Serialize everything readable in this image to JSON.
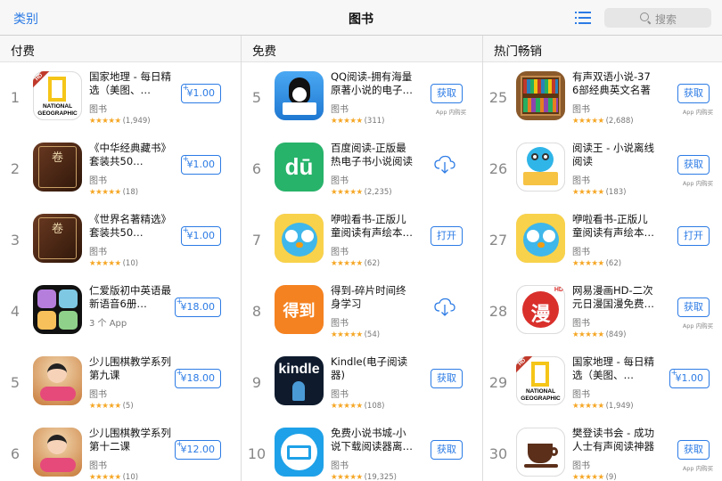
{
  "nav": {
    "back": "类别",
    "title": "图书",
    "search_placeholder": "搜索"
  },
  "columns": [
    {
      "title": "付费",
      "apps": [
        {
          "rank": "1",
          "name": "国家地理 - 每日精选（美图、…",
          "category": "图书",
          "stars": "★★★★★",
          "ratings": "(1,949)",
          "action": "¥1.00",
          "action_type": "price",
          "icon": "natgeo-icon"
        },
        {
          "rank": "2",
          "name": "《中华经典藏书》套装共50…",
          "category": "图书",
          "stars": "★★★★★",
          "ratings": "(18)",
          "action": "¥1.00",
          "action_type": "price",
          "icon": "book-cover-icon"
        },
        {
          "rank": "3",
          "name": "《世界名著精选》套装共50…",
          "category": "图书",
          "stars": "★★★★★",
          "ratings": "(10)",
          "action": "¥1.00",
          "action_type": "price",
          "icon": "book-cover-icon"
        },
        {
          "rank": "4",
          "name": "仁爱版初中英语最新语音6册…",
          "category": "3 个 App",
          "stars": "",
          "ratings": "",
          "action": "¥18.00",
          "action_type": "price",
          "icon": "bundle-icon"
        },
        {
          "rank": "5",
          "name": "少儿围棋教学系列第九课",
          "category": "图书",
          "stars": "★★★★★",
          "ratings": "(5)",
          "action": "¥18.00",
          "action_type": "price",
          "icon": "go-kids-icon"
        },
        {
          "rank": "6",
          "name": "少儿围棋教学系列第十二课",
          "category": "图书",
          "stars": "★★★★★",
          "ratings": "(10)",
          "action": "¥12.00",
          "action_type": "price",
          "icon": "go-kids-icon"
        }
      ]
    },
    {
      "title": "免费",
      "apps": [
        {
          "rank": "5",
          "name": "QQ阅读-拥有海量原著小说的电子…",
          "category": "图书",
          "stars": "★★★★★",
          "ratings": "(311)",
          "action": "获取",
          "action_type": "get",
          "iap": "App 内购买",
          "icon": "qq-penguin-icon"
        },
        {
          "rank": "6",
          "name": "百度阅读-正版最热电子书小说阅读器",
          "category": "图书",
          "stars": "★★★★★",
          "ratings": "(2,235)",
          "action": "",
          "action_type": "cloud",
          "icon": "du-icon"
        },
        {
          "rank": "7",
          "name": "咿啦看书-正版儿童阅读有声绘本…",
          "category": "图书",
          "stars": "★★★★★",
          "ratings": "(62)",
          "action": "打开",
          "action_type": "open",
          "icon": "owl-icon"
        },
        {
          "rank": "8",
          "name": "得到-碎片时间终身学习",
          "category": "图书",
          "stars": "★★★★★",
          "ratings": "(54)",
          "action": "",
          "action_type": "cloud",
          "icon": "dedao-icon"
        },
        {
          "rank": "9",
          "name": "Kindle(电子阅读器)",
          "category": "图书",
          "stars": "★★★★★",
          "ratings": "(108)",
          "action": "获取",
          "action_type": "get",
          "icon": "kindle-icon"
        },
        {
          "rank": "10",
          "name": "免费小说书城-小说下载阅读器离…",
          "category": "图书",
          "stars": "★★★★★",
          "ratings": "(19,325)",
          "action": "获取",
          "action_type": "get",
          "icon": "open-book-icon"
        }
      ]
    },
    {
      "title": "热门畅销",
      "apps": [
        {
          "rank": "25",
          "name": "有声双语小说-376部经典英文名著",
          "category": "图书",
          "stars": "★★★★★",
          "ratings": "(2,688)",
          "action": "获取",
          "action_type": "get",
          "iap": "App 内购买",
          "icon": "bookshelf-icon"
        },
        {
          "rank": "26",
          "name": "阅读王 - 小说离线阅读",
          "category": "图书",
          "stars": "★★★★★",
          "ratings": "(183)",
          "action": "获取",
          "action_type": "get",
          "iap": "App 内购买",
          "icon": "bird-icon"
        },
        {
          "rank": "27",
          "name": "咿啦看书-正版儿童阅读有声绘本…",
          "category": "图书",
          "stars": "★★★★★",
          "ratings": "(62)",
          "action": "打开",
          "action_type": "open",
          "icon": "owl-icon"
        },
        {
          "rank": "28",
          "name": "网易漫画HD-二次元日漫国漫免费…",
          "category": "图书",
          "stars": "★★★★★",
          "ratings": "(849)",
          "action": "获取",
          "action_type": "get",
          "iap": "App 内购买",
          "icon": "manhua-icon"
        },
        {
          "rank": "29",
          "name": "国家地理 - 每日精选（美图、…",
          "category": "图书",
          "stars": "★★★★★",
          "ratings": "(1,949)",
          "action": "¥1.00",
          "action_type": "price",
          "icon": "natgeo-icon"
        },
        {
          "rank": "30",
          "name": "樊登读书会 - 成功人士有声阅读神器",
          "category": "图书",
          "stars": "★★★★★",
          "ratings": "(9)",
          "action": "获取",
          "action_type": "get",
          "iap": "App 内购买",
          "icon": "coffee-cup-icon"
        }
      ]
    }
  ],
  "colors": {
    "accent": "#2c7be5",
    "star": "#f5a623"
  }
}
